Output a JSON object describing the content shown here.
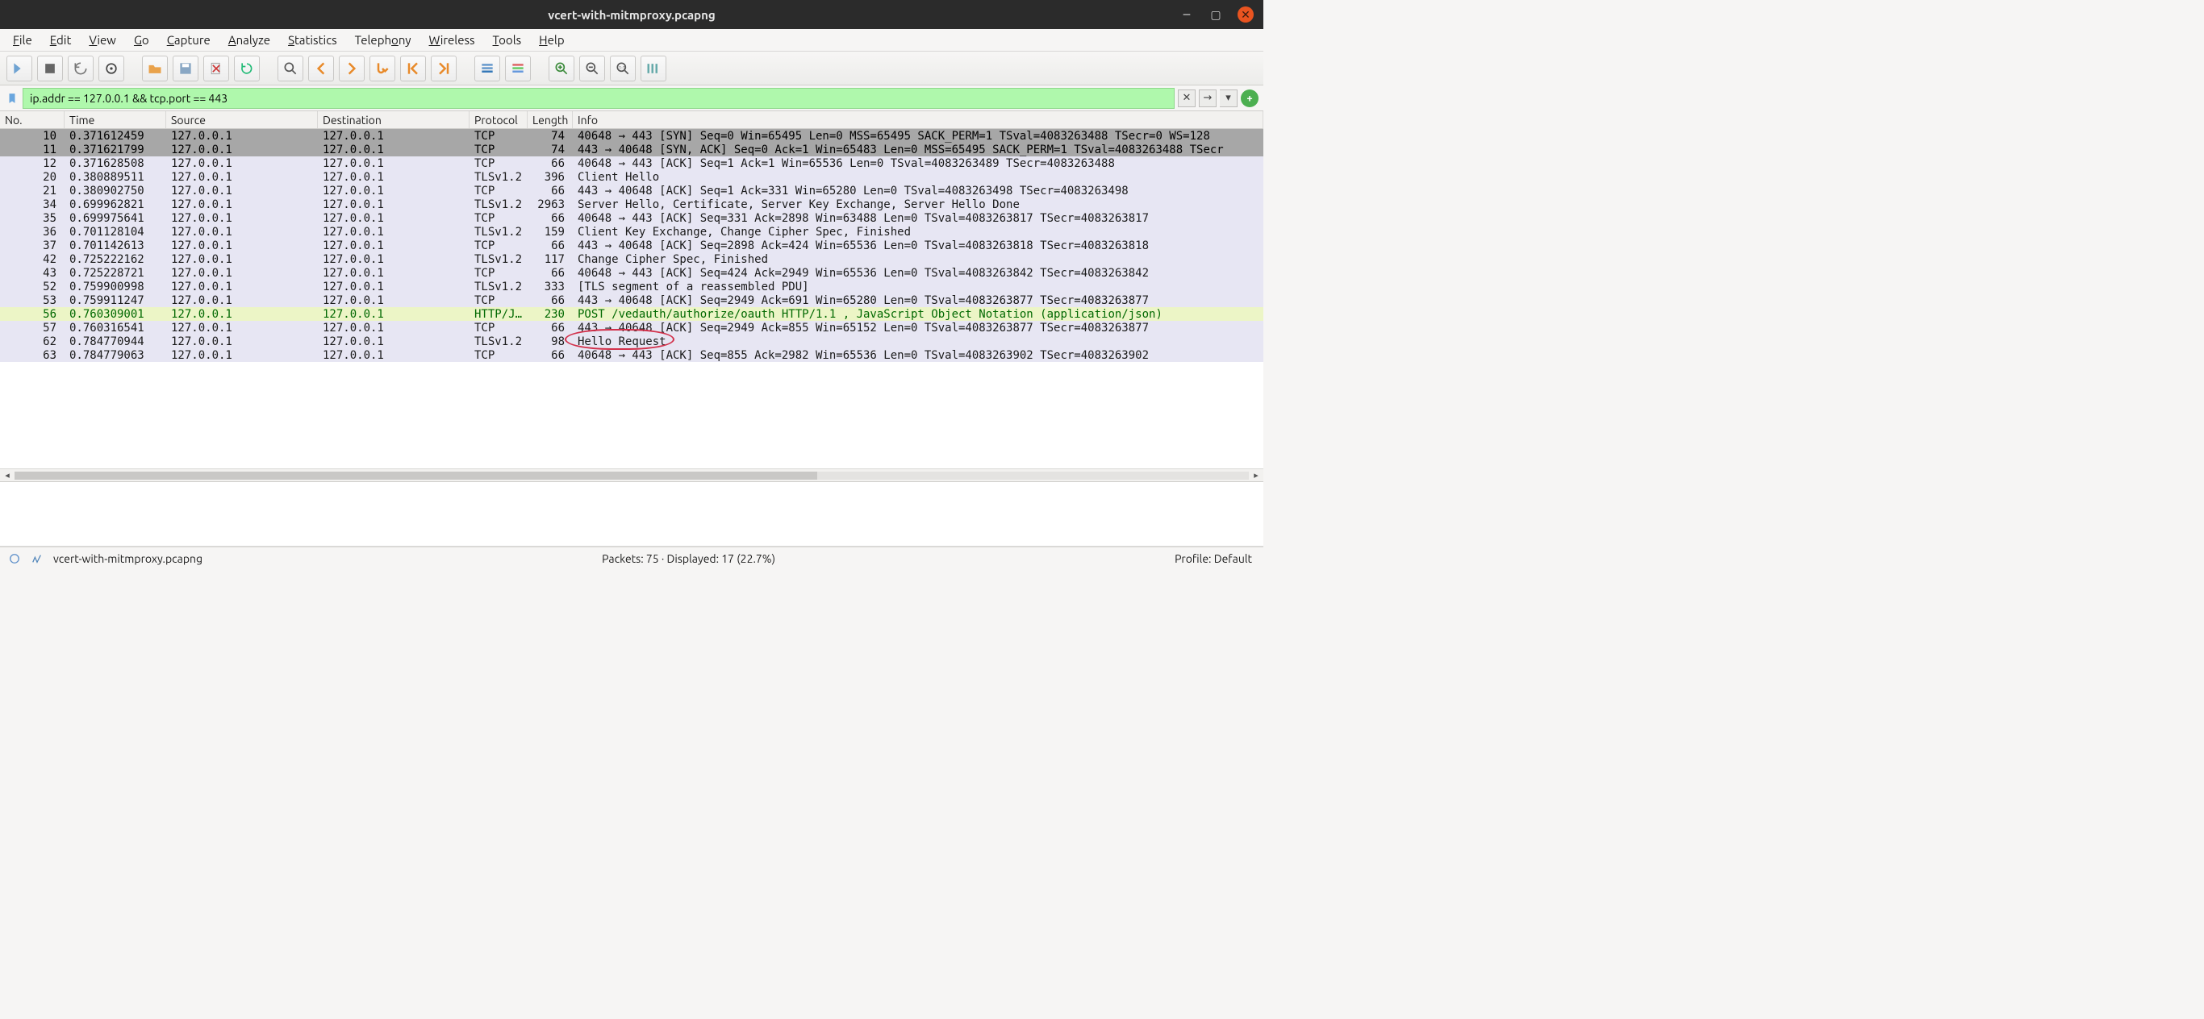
{
  "window": {
    "title": "vcert-with-mitmproxy.pcapng"
  },
  "menu": {
    "items": [
      {
        "label": "File",
        "ak": "F"
      },
      {
        "label": "Edit",
        "ak": "E"
      },
      {
        "label": "View",
        "ak": "V"
      },
      {
        "label": "Go",
        "ak": "G"
      },
      {
        "label": "Capture",
        "ak": "C"
      },
      {
        "label": "Analyze",
        "ak": "A"
      },
      {
        "label": "Statistics",
        "ak": "S"
      },
      {
        "label": "Telephony",
        "ak": "T",
        "ak_index": 6
      },
      {
        "label": "Wireless",
        "ak": "W"
      },
      {
        "label": "Tools",
        "ak": "T"
      },
      {
        "label": "Help",
        "ak": "H"
      }
    ]
  },
  "toolbar": {
    "icons": [
      "fin-icon",
      "stop-icon",
      "restart-icon",
      "options-icon",
      "sep",
      "open-icon",
      "save-icon",
      "close-file-icon",
      "reload-icon",
      "sep",
      "find-icon",
      "back-icon",
      "forward-icon",
      "jump-icon",
      "goto-first-icon",
      "goto-last-icon",
      "sep",
      "autoscroll-icon",
      "colorize-icon",
      "sep",
      "zoom-in-icon",
      "zoom-out-icon",
      "zoom-reset-icon",
      "resize-columns-icon"
    ]
  },
  "filter": {
    "value": "ip.addr == 127.0.0.1 && tcp.port == 443"
  },
  "columns": {
    "no": "No.",
    "time": "Time",
    "source": "Source",
    "destination": "Destination",
    "protocol": "Protocol",
    "length": "Length",
    "info": "Info"
  },
  "packets": [
    {
      "no": 10,
      "time": "0.371612459",
      "src": "127.0.0.1",
      "dst": "127.0.0.1",
      "proto": "TCP",
      "len": 74,
      "info": "40648 → 443 [SYN] Seq=0 Win=65495 Len=0 MSS=65495 SACK_PERM=1 TSval=4083263488 TSecr=0 WS=128",
      "cls": "sel-dark"
    },
    {
      "no": 11,
      "time": "0.371621799",
      "src": "127.0.0.1",
      "dst": "127.0.0.1",
      "proto": "TCP",
      "len": 74,
      "info": "443 → 40648 [SYN, ACK] Seq=0 Ack=1 Win=65483 Len=0 MSS=65495 SACK_PERM=1 TSval=4083263488 TSecr",
      "cls": "sel-dark"
    },
    {
      "no": 12,
      "time": "0.371628508",
      "src": "127.0.0.1",
      "dst": "127.0.0.1",
      "proto": "TCP",
      "len": 66,
      "info": "40648 → 443 [ACK] Seq=1 Ack=1 Win=65536 Len=0 TSval=4083263489 TSecr=4083263488",
      "cls": "even"
    },
    {
      "no": 20,
      "time": "0.380889511",
      "src": "127.0.0.1",
      "dst": "127.0.0.1",
      "proto": "TLSv1.2",
      "len": 396,
      "info": "Client Hello",
      "cls": "even"
    },
    {
      "no": 21,
      "time": "0.380902750",
      "src": "127.0.0.1",
      "dst": "127.0.0.1",
      "proto": "TCP",
      "len": 66,
      "info": "443 → 40648 [ACK] Seq=1 Ack=331 Win=65280 Len=0 TSval=4083263498 TSecr=4083263498",
      "cls": "even"
    },
    {
      "no": 34,
      "time": "0.699962821",
      "src": "127.0.0.1",
      "dst": "127.0.0.1",
      "proto": "TLSv1.2",
      "len": 2963,
      "info": "Server Hello, Certificate, Server Key Exchange, Server Hello Done",
      "cls": "even"
    },
    {
      "no": 35,
      "time": "0.699975641",
      "src": "127.0.0.1",
      "dst": "127.0.0.1",
      "proto": "TCP",
      "len": 66,
      "info": "40648 → 443 [ACK] Seq=331 Ack=2898 Win=63488 Len=0 TSval=4083263817 TSecr=4083263817",
      "cls": "even"
    },
    {
      "no": 36,
      "time": "0.701128104",
      "src": "127.0.0.1",
      "dst": "127.0.0.1",
      "proto": "TLSv1.2",
      "len": 159,
      "info": "Client Key Exchange, Change Cipher Spec, Finished",
      "cls": "even"
    },
    {
      "no": 37,
      "time": "0.701142613",
      "src": "127.0.0.1",
      "dst": "127.0.0.1",
      "proto": "TCP",
      "len": 66,
      "info": "443 → 40648 [ACK] Seq=2898 Ack=424 Win=65536 Len=0 TSval=4083263818 TSecr=4083263818",
      "cls": "even"
    },
    {
      "no": 42,
      "time": "0.725222162",
      "src": "127.0.0.1",
      "dst": "127.0.0.1",
      "proto": "TLSv1.2",
      "len": 117,
      "info": "Change Cipher Spec, Finished",
      "cls": "even"
    },
    {
      "no": 43,
      "time": "0.725228721",
      "src": "127.0.0.1",
      "dst": "127.0.0.1",
      "proto": "TCP",
      "len": 66,
      "info": "40648 → 443 [ACK] Seq=424 Ack=2949 Win=65536 Len=0 TSval=4083263842 TSecr=4083263842",
      "cls": "even"
    },
    {
      "no": 52,
      "time": "0.759900998",
      "src": "127.0.0.1",
      "dst": "127.0.0.1",
      "proto": "TLSv1.2",
      "len": 333,
      "info": "[TLS segment of a reassembled PDU]",
      "cls": "even"
    },
    {
      "no": 53,
      "time": "0.759911247",
      "src": "127.0.0.1",
      "dst": "127.0.0.1",
      "proto": "TCP",
      "len": 66,
      "info": "443 → 40648 [ACK] Seq=2949 Ack=691 Win=65280 Len=0 TSval=4083263877 TSecr=4083263877",
      "cls": "even"
    },
    {
      "no": 56,
      "time": "0.760309001",
      "src": "127.0.0.1",
      "dst": "127.0.0.1",
      "proto": "HTTP/J…",
      "len": 230,
      "info": "POST /vedauth/authorize/oauth HTTP/1.1 , JavaScript Object Notation (application/json)",
      "cls": "http"
    },
    {
      "no": 57,
      "time": "0.760316541",
      "src": "127.0.0.1",
      "dst": "127.0.0.1",
      "proto": "TCP",
      "len": 66,
      "info": "443 → 40648 [ACK] Seq=2949 Ack=855 Win=65152 Len=0 TSval=4083263877 TSecr=4083263877",
      "cls": "even"
    },
    {
      "no": 62,
      "time": "0.784770944",
      "src": "127.0.0.1",
      "dst": "127.0.0.1",
      "proto": "TLSv1.2",
      "len": 98,
      "info": "Hello Request",
      "cls": "even"
    },
    {
      "no": 63,
      "time": "0.784779063",
      "src": "127.0.0.1",
      "dst": "127.0.0.1",
      "proto": "TCP",
      "len": 66,
      "info": "40648 → 443 [ACK] Seq=855 Ack=2982 Win=65536 Len=0 TSval=4083263902 TSecr=4083263902",
      "cls": "even"
    }
  ],
  "status": {
    "file": "vcert-with-mitmproxy.pcapng",
    "packets": "Packets: 75 · Displayed: 17 (22.7%)",
    "profile": "Profile: Default"
  }
}
